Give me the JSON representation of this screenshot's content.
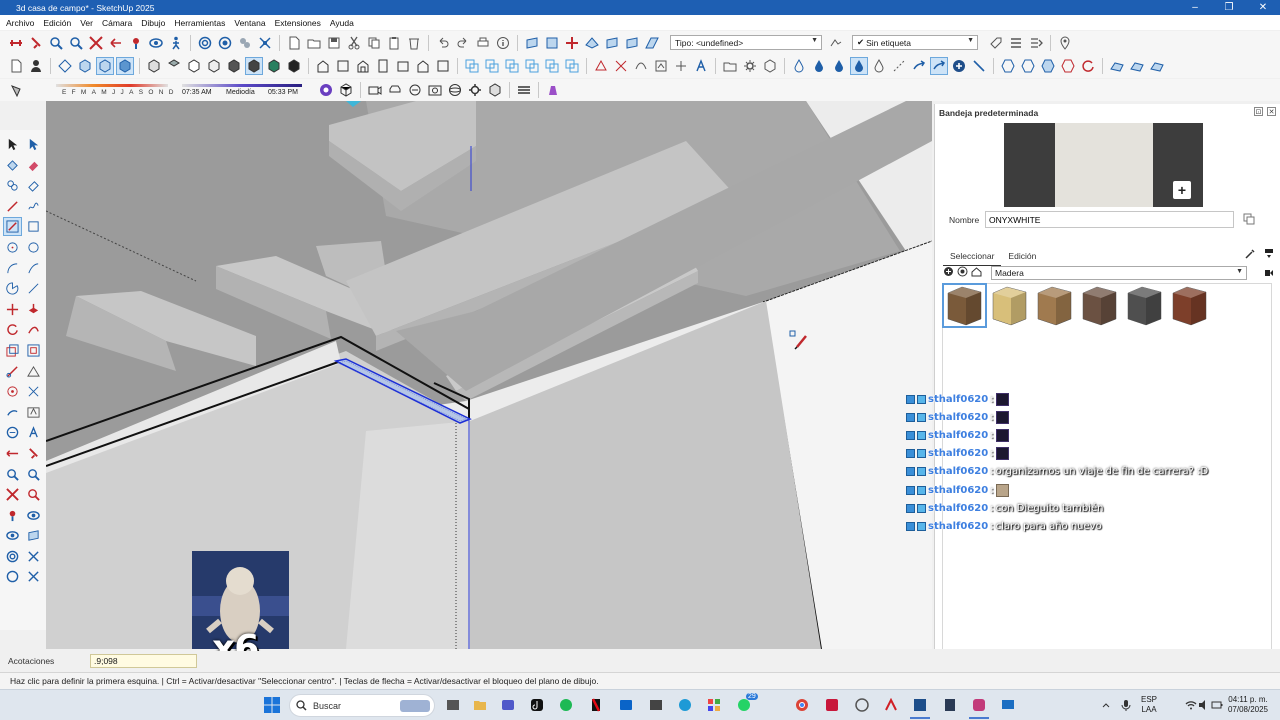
{
  "window": {
    "title": "3d casa de campo* - SketchUp 2025",
    "minimize": "–",
    "maximize": "❐",
    "close": "✕"
  },
  "menu": [
    "Archivo",
    "Edición",
    "Ver",
    "Cámara",
    "Dibujo",
    "Herramientas",
    "Ventana",
    "Extensiones",
    "Ayuda"
  ],
  "toolbar": {
    "type_combo": "Tipo: <undefined>",
    "tag_combo": "Sin etiqueta",
    "tag_check": "✔"
  },
  "shadows": {
    "months": [
      "E",
      "F",
      "M",
      "A",
      "M",
      "J",
      "J",
      "A",
      "S",
      "O",
      "N",
      "D"
    ],
    "time_start": "07:35 AM",
    "time_mid": "Mediodía",
    "time_end": "05:33 PM"
  },
  "tray": {
    "title": "Bandeja predeterminada",
    "name_label": "Nombre",
    "material_name": "ONYXWHITE",
    "tab_select": "Seleccionar",
    "tab_edit": "Edición",
    "library": "Madera",
    "materials": [
      {
        "color": "#7a5a3a",
        "selected": true
      },
      {
        "color": "#d8bf7a",
        "selected": false
      },
      {
        "color": "#a07a4f",
        "selected": false
      },
      {
        "color": "#6b5142",
        "selected": false
      },
      {
        "color": "#4f4f4f",
        "selected": false
      },
      {
        "color": "#7d3f2a",
        "selected": false
      }
    ]
  },
  "chat": [
    {
      "user": "sthalf0620",
      "sep": ":",
      "msg": "",
      "emote": "dark"
    },
    {
      "user": "sthalf0620",
      "sep": ":",
      "msg": "",
      "emote": "dark"
    },
    {
      "user": "sthalf0620",
      "sep": ":",
      "msg": "",
      "emote": "dark"
    },
    {
      "user": "sthalf0620",
      "sep": ":",
      "msg": "",
      "emote": "dark"
    },
    {
      "user": "sthalf0620",
      "sep": ":",
      "msg": "organizamos un viaje de fin de carrera? :D",
      "emote": ""
    },
    {
      "user": "sthalf0620",
      "sep": ":",
      "msg": "",
      "emote": "cat"
    },
    {
      "user": "sthalf0620",
      "sep": ":",
      "msg": "con Dieguito también",
      "emote": ""
    },
    {
      "user": "sthalf0620",
      "sep": ":",
      "msg": "claro para año nuevo",
      "emote": ""
    }
  ],
  "overlay": {
    "multiplier": "x6"
  },
  "measurements": {
    "label": "Acotaciones",
    "value": ".9;098"
  },
  "status": {
    "text": "Haz clic para definir la primera esquina. | Ctrl = Activar/desactivar \"Seleccionar centro\". | Teclas de flecha = Activar/desactivar el bloqueo del plano de dibujo."
  },
  "taskbar": {
    "search_label": "Buscar",
    "lang_top": "ESP",
    "lang_bottom": "LAA",
    "time": "04:11 p. m.",
    "date": "07/08/2025",
    "whatsapp_badge": "29"
  }
}
